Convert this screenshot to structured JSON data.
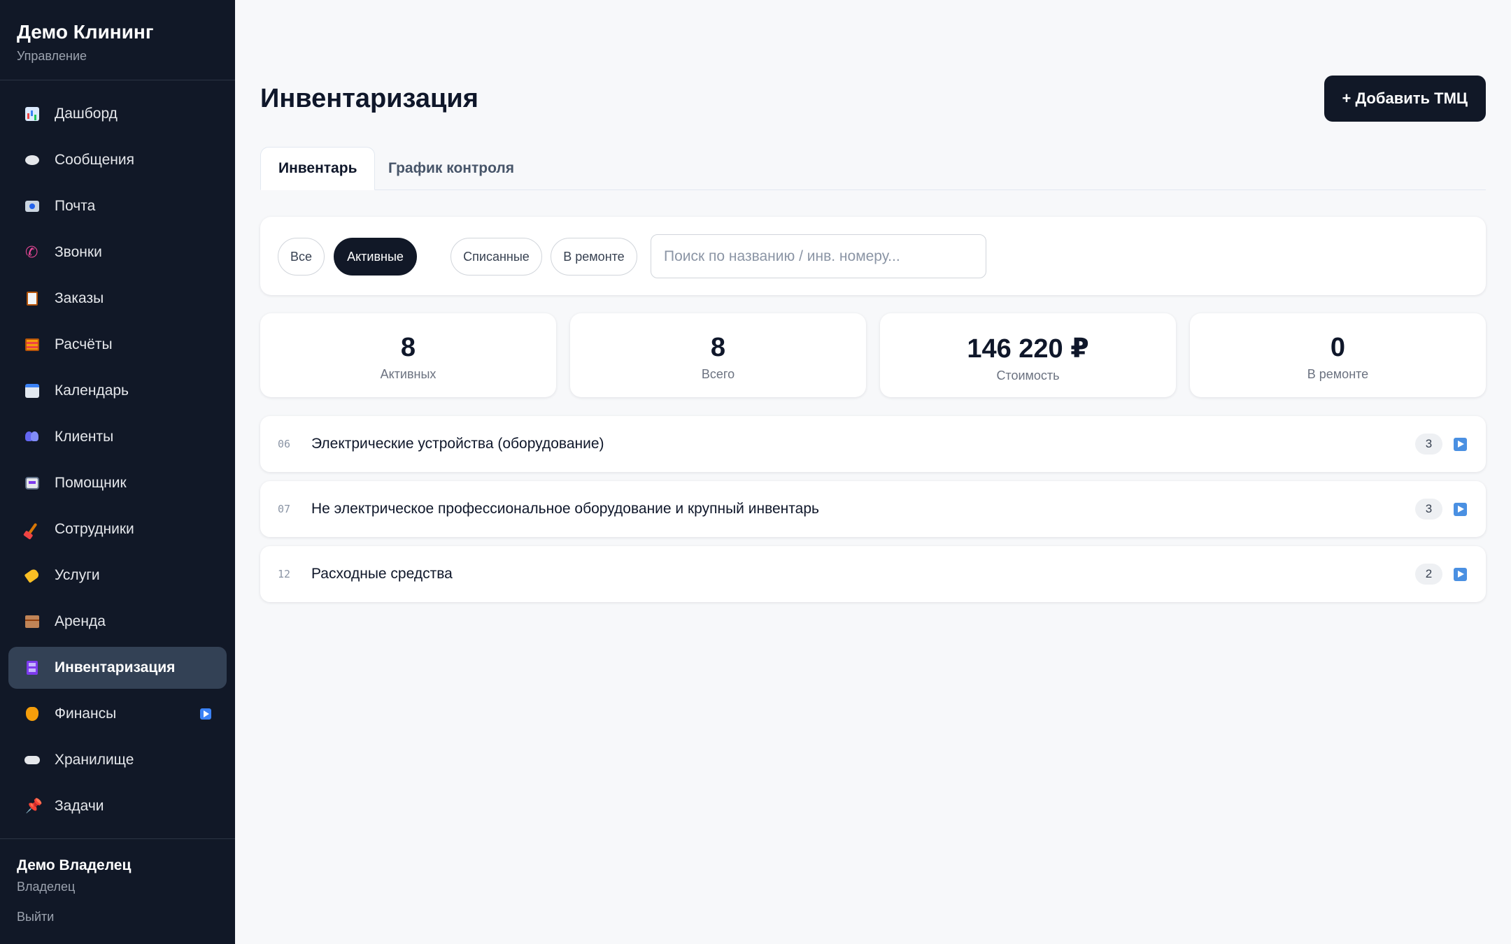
{
  "sidebar": {
    "brand_title": "Демо Клининг",
    "brand_subtitle": "Управление",
    "items": [
      {
        "label": "Дашборд",
        "icon": "chart-icon"
      },
      {
        "label": "Сообщения",
        "icon": "speech-bubble-icon"
      },
      {
        "label": "Почта",
        "icon": "mail-icon"
      },
      {
        "label": "Звонки",
        "icon": "phone-icon"
      },
      {
        "label": "Заказы",
        "icon": "clipboard-icon"
      },
      {
        "label": "Расчёты",
        "icon": "abacus-icon"
      },
      {
        "label": "Календарь",
        "icon": "calendar-icon"
      },
      {
        "label": "Клиенты",
        "icon": "users-icon"
      },
      {
        "label": "Помощник",
        "icon": "robot-icon"
      },
      {
        "label": "Сотрудники",
        "icon": "broom-icon"
      },
      {
        "label": "Услуги",
        "icon": "tag-icon"
      },
      {
        "label": "Аренда",
        "icon": "package-icon"
      },
      {
        "label": "Инвентаризация",
        "icon": "file-cabinet-icon",
        "active": true
      },
      {
        "label": "Финансы",
        "icon": "money-bag-icon",
        "badge": "play-icon"
      },
      {
        "label": "Хранилище",
        "icon": "cloud-icon"
      },
      {
        "label": "Задачи",
        "icon": "pin-icon"
      }
    ],
    "user_name": "Демо Владелец",
    "user_role": "Владелец",
    "logout_label": "Выйти"
  },
  "main": {
    "title": "Инвентаризация",
    "add_button_label": "+ Добавить ТМЦ",
    "tabs": [
      {
        "label": "Инвентарь",
        "active": true
      },
      {
        "label": "График контроля",
        "active": false
      }
    ],
    "filters": [
      {
        "label": "Все",
        "active": false
      },
      {
        "label": "Активные",
        "active": true
      },
      {
        "label": "Списанные",
        "active": false
      },
      {
        "label": "В ремонте",
        "active": false
      }
    ],
    "search_placeholder": "Поиск по названию / инв. номеру...",
    "search_value": "",
    "stats": [
      {
        "value": "8",
        "label": "Активных"
      },
      {
        "value": "8",
        "label": "Всего"
      },
      {
        "value": "146 220 ₽",
        "label": "Стоимость"
      },
      {
        "value": "0",
        "label": "В ремонте"
      }
    ],
    "categories": [
      {
        "code": "06",
        "name": "Электрические устройства (оборудование)",
        "count": "3"
      },
      {
        "code": "07",
        "name": "Не электрическое профессиональное оборудование и крупный инвентарь",
        "count": "3"
      },
      {
        "code": "12",
        "name": "Расходные средства",
        "count": "2"
      }
    ]
  },
  "colors": {
    "sidebar_bg": "#111827",
    "active_nav_bg": "#334155",
    "accent_dark": "#111827",
    "page_bg": "#f7f8fa",
    "play_badge": "#4a90e2"
  }
}
